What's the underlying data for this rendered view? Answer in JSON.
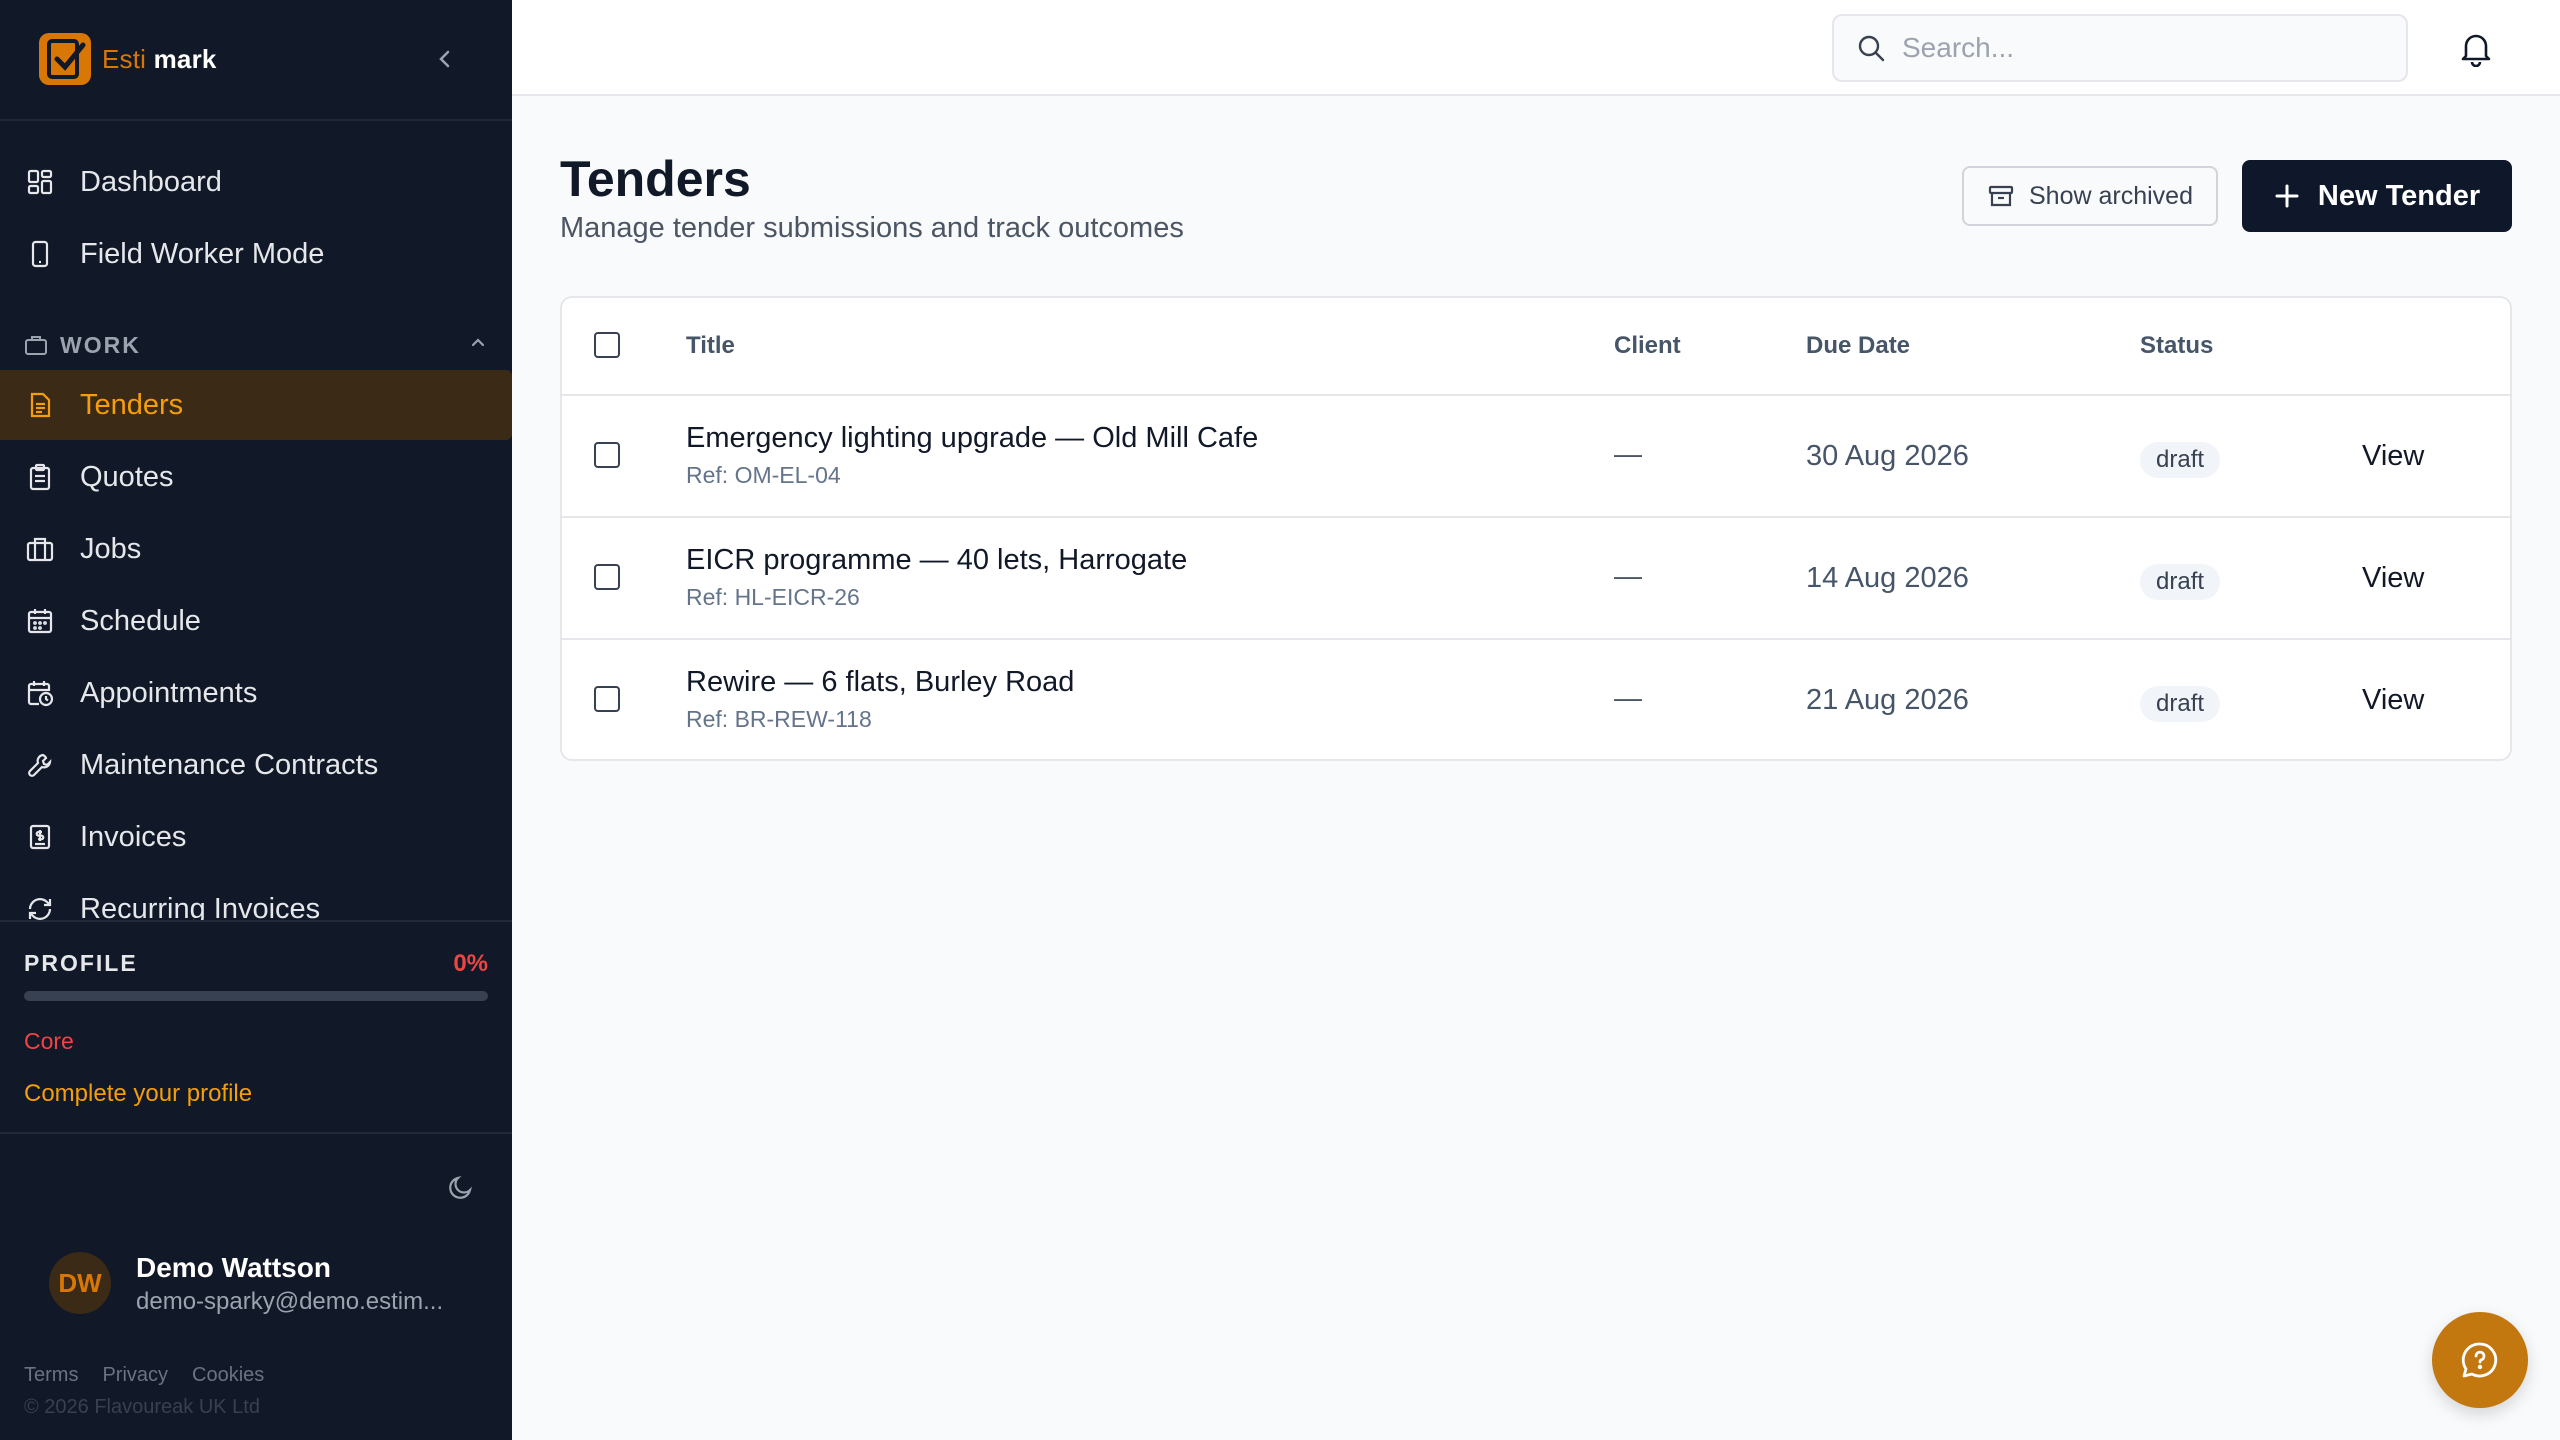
{
  "brand": {
    "name_part1": "Esti",
    "name_part2": "mark"
  },
  "nav": {
    "top_items": [
      {
        "label": "Dashboard",
        "icon": "grid-icon"
      },
      {
        "label": "Field Worker Mode",
        "icon": "phone-icon"
      }
    ],
    "section_label": "WORK",
    "work_items": [
      {
        "label": "Tenders",
        "icon": "document-icon",
        "active": true
      },
      {
        "label": "Quotes",
        "icon": "clipboard-icon"
      },
      {
        "label": "Jobs",
        "icon": "briefcase-icon"
      },
      {
        "label": "Schedule",
        "icon": "calendar-icon"
      },
      {
        "label": "Appointments",
        "icon": "calendar-clock-icon"
      },
      {
        "label": "Maintenance Contracts",
        "icon": "wrench-icon"
      },
      {
        "label": "Invoices",
        "icon": "receipt-icon"
      },
      {
        "label": "Recurring Invoices",
        "icon": "refresh-icon"
      }
    ]
  },
  "profile": {
    "title": "PROFILE",
    "percent_label": "0%",
    "progress": 0,
    "core_label": "Core",
    "complete_link": "Complete your profile"
  },
  "user": {
    "initials": "DW",
    "name": "Demo Wattson",
    "email": "demo-sparky@demo.estim..."
  },
  "footer": {
    "links": [
      "Terms",
      "Privacy",
      "Cookies"
    ],
    "copyright": "© 2026 Flavoureak UK Ltd"
  },
  "search": {
    "placeholder": "Search..."
  },
  "page": {
    "title": "Tenders",
    "subtitle": "Manage tender submissions and track outcomes",
    "show_archived_label": "Show archived",
    "new_tender_label": "New Tender"
  },
  "table": {
    "columns": [
      "Title",
      "Client",
      "Due Date",
      "Status"
    ],
    "rows": [
      {
        "title": "Emergency lighting upgrade — Old Mill Cafe",
        "ref": "Ref: OM-EL-04",
        "client": "—",
        "due": "30 Aug 2026",
        "status": "draft",
        "action": "View"
      },
      {
        "title": "EICR programme — 40 lets, Harrogate",
        "ref": "Ref: HL-EICR-26",
        "client": "—",
        "due": "14 Aug 2026",
        "status": "draft",
        "action": "View"
      },
      {
        "title": "Rewire — 6 flats, Burley Road",
        "ref": "Ref: BR-REW-118",
        "client": "—",
        "due": "21 Aug 2026",
        "status": "draft",
        "action": "View"
      }
    ]
  },
  "colors": {
    "accent": "#d97706",
    "sidebar_bg": "#111827",
    "primary_button": "#0f172a",
    "danger": "#ef4444"
  }
}
